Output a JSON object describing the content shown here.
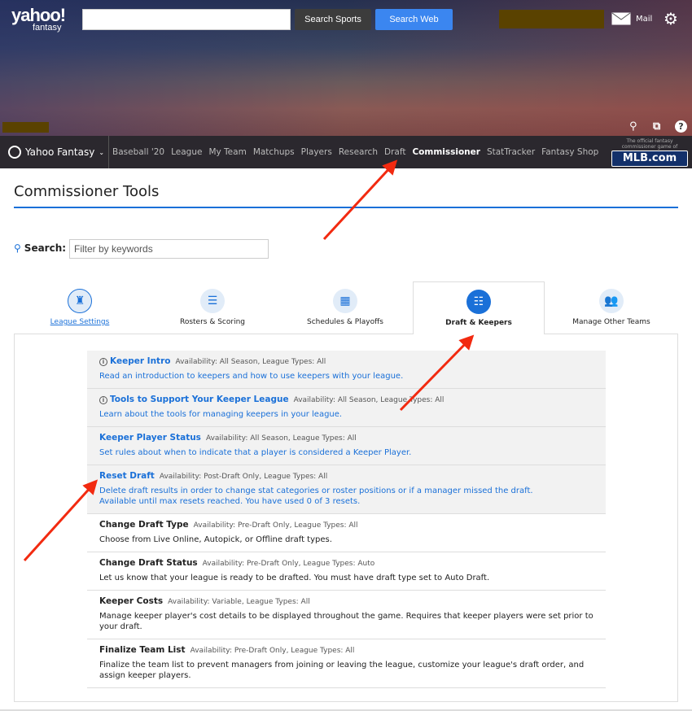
{
  "header": {
    "logo_top": "yahoo!",
    "logo_bottom": "fantasy",
    "search_placeholder": "",
    "search_sports": "Search Sports",
    "search_web": "Search Web",
    "mail": "Mail",
    "icons": [
      "search-icon",
      "chat-icon",
      "help-icon"
    ]
  },
  "nav": {
    "brand": "Yahoo Fantasy",
    "items": [
      "Baseball '20",
      "League",
      "My Team",
      "Matchups",
      "Players",
      "Research",
      "Draft",
      "Commissioner",
      "StatTracker",
      "Fantasy Shop"
    ],
    "active": "Commissioner",
    "mlb_tag": "The official fantasy commissioner game of",
    "mlb": "MLB.com"
  },
  "page": {
    "title": "Commissioner Tools",
    "search_label": "Search:",
    "search_placeholder": "Filter by keywords"
  },
  "tabs": [
    {
      "label": "League Settings",
      "icon": "trophy-icon"
    },
    {
      "label": "Rosters & Scoring",
      "icon": "list-icon"
    },
    {
      "label": "Schedules & Playoffs",
      "icon": "calendar-icon"
    },
    {
      "label": "Draft & Keepers",
      "icon": "draft-board-icon",
      "active": true
    },
    {
      "label": "Manage Other Teams",
      "icon": "users-icon"
    }
  ],
  "tools": [
    {
      "name": "Keeper Intro",
      "meta": "Availability: All Season,  League Types: All",
      "desc": "Read an introduction to keepers and how to use keepers with your league.",
      "info": true,
      "enabled": true
    },
    {
      "name": "Tools to Support Your Keeper League",
      "meta": "Availability: All Season,  League Types: All",
      "desc": "Learn about the tools for managing keepers in your league.",
      "info": true,
      "enabled": true
    },
    {
      "name": "Keeper Player Status",
      "meta": "Availability: All Season,  League Types: All",
      "desc": "Set rules about when to indicate that a player is considered a Keeper Player.",
      "enabled": true
    },
    {
      "name": "Reset Draft",
      "meta": "Availability: Post-Draft Only,  League Types: All",
      "desc": "Delete draft results in order to change stat categories or roster positions or if a manager missed the draft.",
      "desc2": "Available until max resets reached. You have used 0 of 3 resets.",
      "enabled": true
    },
    {
      "name": "Change Draft Type",
      "meta": "Availability: Pre-Draft Only,  League Types: All",
      "desc": "Choose from Live Online, Autopick, or Offline draft types."
    },
    {
      "name": "Change Draft Status",
      "meta": "Availability: Pre-Draft Only,  League Types: Auto",
      "desc": "Let us know that your league is ready to be drafted. You must have draft type set to Auto Draft."
    },
    {
      "name": "Keeper Costs",
      "meta": "Availability: Variable,  League Types: All",
      "desc": "Manage keeper player's cost details to be displayed throughout the game. Requires that keeper players were set prior to your draft."
    },
    {
      "name": "Finalize Team List",
      "meta": "Availability: Pre-Draft Only,  League Types: All",
      "desc": "Finalize the team list to prevent managers from joining or leaving the league, customize your league's draft order, and assign keeper players."
    }
  ],
  "colors": {
    "accent": "#1a70d8",
    "annotation_arrow": "#f22a10"
  }
}
